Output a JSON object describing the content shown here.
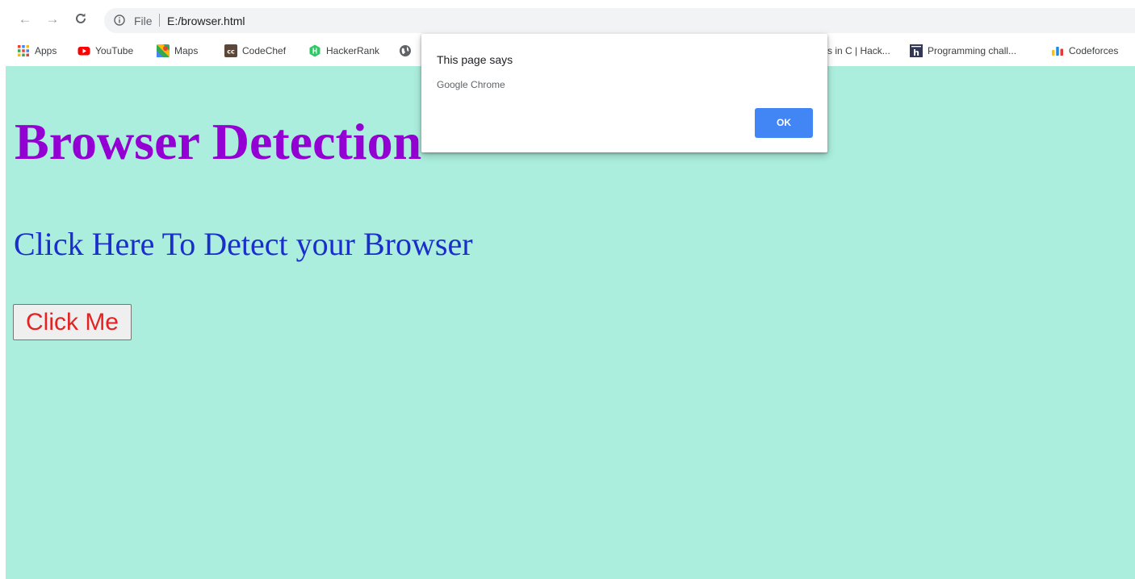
{
  "address_bar": {
    "scheme": "File",
    "url": "E:/browser.html"
  },
  "bookmarks": [
    {
      "label": "Apps",
      "icon": "apps-grid-icon"
    },
    {
      "label": "YouTube",
      "icon": "youtube-icon"
    },
    {
      "label": "Maps",
      "icon": "maps-icon"
    },
    {
      "label": "CodeChef",
      "icon": "codechef-icon"
    },
    {
      "label": "HackerRank",
      "icon": "hackerrank-icon"
    },
    {
      "label": "",
      "icon": "globe-icon"
    },
    {
      "label": "s in C | Hack...",
      "icon": ""
    },
    {
      "label": "Programming chall...",
      "icon": "hackerearth-icon"
    },
    {
      "label": "Codeforces",
      "icon": "codeforces-icon"
    }
  ],
  "page": {
    "heading": "Browser Detection",
    "subheading": "Click Here To Detect your Browser",
    "button_label": "Click Me"
  },
  "dialog": {
    "title": "This page says",
    "message": "Google Chrome",
    "ok_label": "OK"
  },
  "colors": {
    "page_background": "#abeedd",
    "heading": "#9400d3",
    "subheading": "#1a2ecc",
    "button_text": "#e52222",
    "ok_button": "#4285f4"
  }
}
